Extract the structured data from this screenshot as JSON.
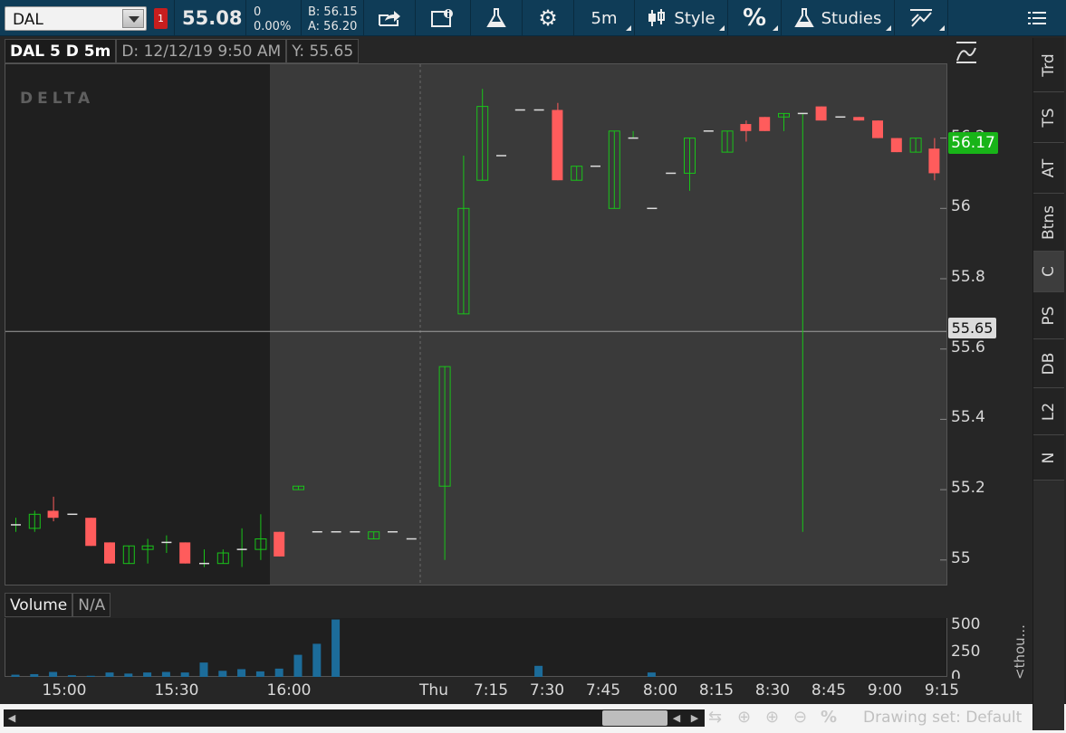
{
  "toolbar": {
    "symbol": "DAL",
    "alert_count": "1",
    "last_price": "55.08",
    "net_change": "0",
    "pct_change": "0.00%",
    "bid": "B: 56.15",
    "ask": "A: 56.20",
    "aggregation": "5m",
    "style_label": "Style",
    "percent_label": "%",
    "studies_label": "Studies",
    "icons": [
      "share-icon",
      "info-icon",
      "flask-icon",
      "gear-icon",
      "candlestick-icon",
      "studies-flask-icon",
      "drawings-icon",
      "menu-icon"
    ]
  },
  "chart_header": {
    "title": "DAL 5 D 5m",
    "date": "D: 12/12/19 9:50 AM",
    "y_value": "Y: 55.65"
  },
  "watermark": "DELTA",
  "price_axis": {
    "labels": [
      "56.2",
      "56",
      "55.8",
      "55.6",
      "55.4",
      "55.2",
      "55"
    ],
    "crosshair_value": "55.65",
    "last_value": "56.17"
  },
  "volume": {
    "title": "Volume",
    "value": "N/A",
    "axis_labels": [
      "500",
      "250",
      "0"
    ],
    "unit_label": "<thou..."
  },
  "time_axis": [
    "15:00",
    "15:30",
    "16:00",
    "Thu",
    "7:15",
    "7:30",
    "7:45",
    "8:00",
    "8:15",
    "8:30",
    "8:45",
    "9:00",
    "9:15"
  ],
  "bottom_bar": {
    "drawing_set": "Drawing set: Default"
  },
  "side_tabs": [
    "Trd",
    "TS",
    "AT",
    "Btns",
    "C",
    "PS",
    "DB",
    "L2",
    "N"
  ],
  "colors": {
    "toolbar_bg": "#0f3c57",
    "up": "#19c419",
    "down": "#ff5c5c",
    "volume": "#1c6c9a",
    "last_tag": "#18b418"
  },
  "chart_data": {
    "type": "candlestick",
    "ylim": [
      54.93,
      56.41
    ],
    "ticks": [
      55.0,
      55.2,
      55.4,
      55.6,
      55.8,
      56.0,
      56.2
    ],
    "candles": [
      {
        "t": "14:55",
        "o": 55.1,
        "h": 55.12,
        "l": 55.08,
        "c": 55.1
      },
      {
        "t": "15:00",
        "o": 55.09,
        "h": 55.14,
        "l": 55.08,
        "c": 55.13
      },
      {
        "t": "15:05",
        "o": 55.14,
        "h": 55.18,
        "l": 55.11,
        "c": 55.12
      },
      {
        "t": "15:10",
        "o": 55.13,
        "h": 55.13,
        "l": 55.13,
        "c": 55.13
      },
      {
        "t": "15:15",
        "o": 55.12,
        "h": 55.12,
        "l": 55.04,
        "c": 55.04
      },
      {
        "t": "15:20",
        "o": 55.05,
        "h": 55.05,
        "l": 54.99,
        "c": 54.99
      },
      {
        "t": "15:25",
        "o": 54.99,
        "h": 55.04,
        "l": 54.99,
        "c": 55.04
      },
      {
        "t": "15:30",
        "o": 55.03,
        "h": 55.06,
        "l": 54.99,
        "c": 55.04
      },
      {
        "t": "15:35",
        "o": 55.05,
        "h": 55.07,
        "l": 55.02,
        "c": 55.05
      },
      {
        "t": "15:40",
        "o": 55.05,
        "h": 55.05,
        "l": 54.99,
        "c": 54.99
      },
      {
        "t": "15:45",
        "o": 54.99,
        "h": 55.03,
        "l": 54.98,
        "c": 54.99
      },
      {
        "t": "15:50",
        "o": 54.99,
        "h": 55.03,
        "l": 54.99,
        "c": 55.02
      },
      {
        "t": "15:55",
        "o": 55.03,
        "h": 55.09,
        "l": 54.98,
        "c": 55.03
      },
      {
        "t": "16:00",
        "o": 55.03,
        "h": 55.13,
        "l": 55.0,
        "c": 55.06
      },
      {
        "t": "16:05",
        "o": 55.08,
        "h": 55.08,
        "l": 55.01,
        "c": 55.01
      },
      {
        "t": "16:10",
        "o": 55.2,
        "h": 55.21,
        "l": 55.2,
        "c": 55.21
      },
      {
        "t": "16:15",
        "o": 55.08,
        "h": 55.08,
        "l": 55.08,
        "c": 55.08
      },
      {
        "t": "16:20",
        "o": 55.08,
        "h": 55.08,
        "l": 55.08,
        "c": 55.08
      },
      {
        "t": "16:25",
        "o": 55.08,
        "h": 55.08,
        "l": 55.08,
        "c": 55.08
      },
      {
        "t": "16:30",
        "o": 55.06,
        "h": 55.08,
        "l": 55.06,
        "c": 55.08
      },
      {
        "t": "16:35",
        "o": 55.08,
        "h": 55.08,
        "l": 55.08,
        "c": 55.08
      },
      {
        "t": "16:40",
        "o": 55.06,
        "h": 55.06,
        "l": 55.06,
        "c": 55.06
      },
      {
        "t": "7:00",
        "o": 55.21,
        "h": 55.55,
        "l": 55.0,
        "c": 55.55
      },
      {
        "t": "7:05",
        "o": 55.7,
        "h": 56.15,
        "l": 55.7,
        "c": 56.0
      },
      {
        "t": "7:10",
        "o": 56.08,
        "h": 56.34,
        "l": 56.08,
        "c": 56.29
      },
      {
        "t": "7:15",
        "o": 56.15,
        "h": 56.15,
        "l": 56.15,
        "c": 56.15
      },
      {
        "t": "7:20",
        "o": 56.28,
        "h": 56.28,
        "l": 56.28,
        "c": 56.28
      },
      {
        "t": "7:25",
        "o": 56.28,
        "h": 56.28,
        "l": 56.28,
        "c": 56.28
      },
      {
        "t": "7:30",
        "o": 56.28,
        "h": 56.3,
        "l": 56.08,
        "c": 56.08
      },
      {
        "t": "7:35",
        "o": 56.08,
        "h": 56.12,
        "l": 56.08,
        "c": 56.12
      },
      {
        "t": "7:40",
        "o": 56.12,
        "h": 56.12,
        "l": 56.12,
        "c": 56.12
      },
      {
        "t": "7:45",
        "o": 56.0,
        "h": 56.22,
        "l": 56.0,
        "c": 56.22
      },
      {
        "t": "7:50",
        "o": 56.2,
        "h": 56.22,
        "l": 56.2,
        "c": 56.2
      },
      {
        "t": "7:55",
        "o": 56.0,
        "h": 56.0,
        "l": 56.0,
        "c": 56.0
      },
      {
        "t": "8:00",
        "o": 56.1,
        "h": 56.1,
        "l": 56.1,
        "c": 56.1
      },
      {
        "t": "8:05",
        "o": 56.1,
        "h": 56.2,
        "l": 56.05,
        "c": 56.2
      },
      {
        "t": "8:10",
        "o": 56.22,
        "h": 56.22,
        "l": 56.22,
        "c": 56.22
      },
      {
        "t": "8:15",
        "o": 56.16,
        "h": 56.22,
        "l": 56.16,
        "c": 56.22
      },
      {
        "t": "8:20",
        "o": 56.24,
        "h": 56.25,
        "l": 56.19,
        "c": 56.22
      },
      {
        "t": "8:25",
        "o": 56.26,
        "h": 56.26,
        "l": 56.22,
        "c": 56.22
      },
      {
        "t": "8:30",
        "o": 56.26,
        "h": 56.27,
        "l": 56.22,
        "c": 56.27
      },
      {
        "t": "8:35",
        "o": 56.27,
        "h": 56.27,
        "l": 55.08,
        "c": 56.27
      },
      {
        "t": "8:40",
        "o": 56.29,
        "h": 56.29,
        "l": 56.25,
        "c": 56.25
      },
      {
        "t": "8:45",
        "o": 56.26,
        "h": 56.26,
        "l": 56.26,
        "c": 56.26
      },
      {
        "t": "8:50",
        "o": 56.26,
        "h": 56.26,
        "l": 56.25,
        "c": 56.25
      },
      {
        "t": "8:55",
        "o": 56.25,
        "h": 56.25,
        "l": 56.2,
        "c": 56.2
      },
      {
        "t": "9:00",
        "o": 56.2,
        "h": 56.2,
        "l": 56.16,
        "c": 56.16
      },
      {
        "t": "9:05",
        "o": 56.16,
        "h": 56.2,
        "l": 56.16,
        "c": 56.2
      },
      {
        "t": "9:10",
        "o": 56.17,
        "h": 56.2,
        "l": 56.08,
        "c": 56.1
      },
      {
        "t": "9:15",
        "o": 56.1,
        "h": 56.17,
        "l": 56.1,
        "c": 56.17
      }
    ],
    "volume_ylim": [
      0,
      500
    ],
    "volume": [
      20,
      25,
      45,
      15,
      10,
      40,
      30,
      40,
      45,
      40,
      130,
      55,
      70,
      50,
      75,
      200,
      300,
      520,
      0,
      0,
      0,
      0,
      0,
      0,
      0,
      0,
      0,
      100,
      0,
      0,
      0,
      0,
      0,
      40,
      0,
      0,
      0,
      0,
      0,
      0,
      0,
      0,
      0,
      0,
      0,
      0,
      0,
      0,
      0,
      0
    ],
    "crosshair_y": 55.65,
    "last": 56.17
  }
}
